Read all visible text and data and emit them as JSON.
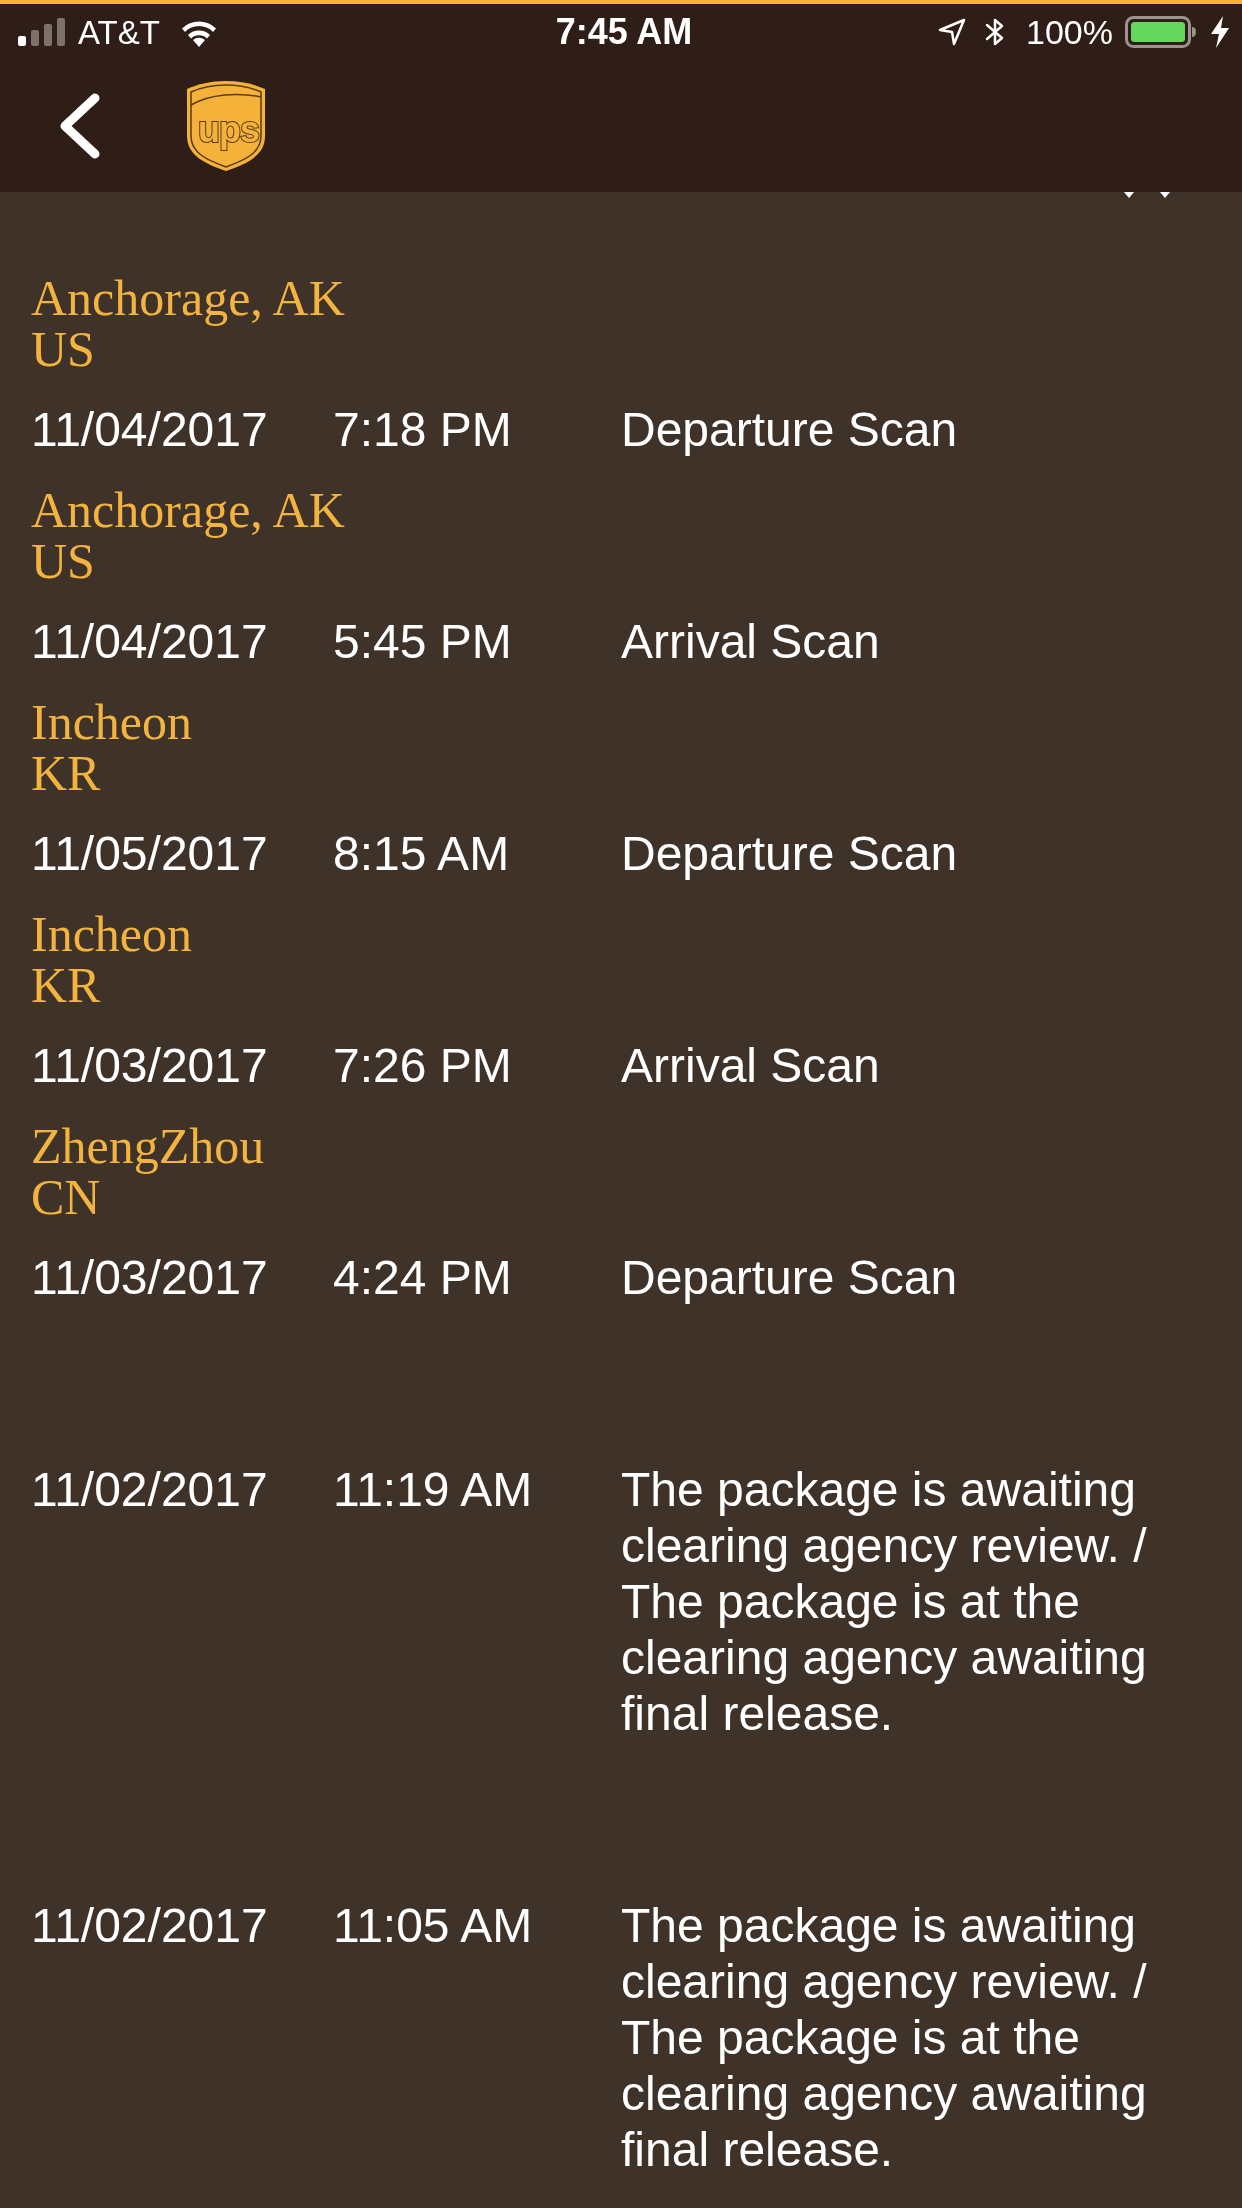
{
  "status_bar": {
    "carrier": "AT&T",
    "time": "7:45 AM",
    "battery": "100%"
  },
  "header": {
    "logo_text": "ups"
  },
  "activities": [
    {
      "location": {
        "city": "Anchorage, AK",
        "country": "US"
      },
      "date": "11/04/2017",
      "time": "7:18 PM",
      "description": "Departure Scan"
    },
    {
      "location": {
        "city": "Anchorage, AK",
        "country": "US"
      },
      "date": "11/04/2017",
      "time": "5:45 PM",
      "description": "Arrival Scan"
    },
    {
      "location": {
        "city": "Incheon",
        "country": "KR"
      },
      "date": "11/05/2017",
      "time": "8:15 AM",
      "description": "Departure Scan"
    },
    {
      "location": {
        "city": "Incheon",
        "country": "KR"
      },
      "date": "11/03/2017",
      "time": "7:26 PM",
      "description": "Arrival Scan"
    },
    {
      "location": {
        "city": "ZhengZhou",
        "country": "CN"
      },
      "date": "11/03/2017",
      "time": "4:24 PM",
      "description": "Departure Scan"
    },
    {
      "date": "11/02/2017",
      "time": "11:19 AM",
      "description": "The package is awaiting clearing agency review. / The package is at the clearing agency awaiting final release."
    },
    {
      "date": "11/02/2017",
      "time": "11:05 AM",
      "description": "The package is awaiting clearing agency review. / The package is at the clearing agency awaiting final release."
    }
  ]
}
